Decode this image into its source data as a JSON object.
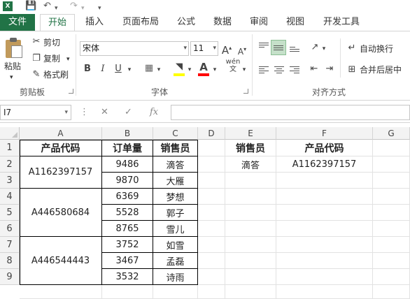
{
  "quick_access": {
    "app_icon": "X",
    "icons": [
      "save-icon",
      "undo-icon",
      "redo-icon",
      "customize-icon"
    ]
  },
  "tabs": [
    "文件",
    "开始",
    "插入",
    "页面布局",
    "公式",
    "数据",
    "审阅",
    "视图",
    "开发工具"
  ],
  "active_tab": "开始",
  "ribbon": {
    "clipboard": {
      "paste": "粘贴",
      "cut": "剪切",
      "copy": "复制",
      "format_painter": "格式刷",
      "group": "剪贴板"
    },
    "font": {
      "name": "宋体",
      "size": "11",
      "grow": "A",
      "shrink": "A",
      "bold": "B",
      "italic": "I",
      "underline": "U",
      "font_color": "A",
      "phonetic": "wén",
      "phonetic_sub": "文",
      "group": "字体",
      "fill_color": "#ffff00",
      "font_color_bar": "#ff0000"
    },
    "alignment": {
      "wrap_text": "自动换行",
      "merge_center": "合并后居中",
      "group": "对齐方式"
    }
  },
  "formula_bar": {
    "name_box": "I7",
    "fx": "fx",
    "value": ""
  },
  "columns": [
    "A",
    "B",
    "C",
    "D",
    "E",
    "F",
    "G"
  ],
  "rows": [
    "1",
    "2",
    "3",
    "4",
    "5",
    "6",
    "7",
    "8",
    "9"
  ],
  "sheet": {
    "headers": {
      "a1": "产品代码",
      "b1": "订单量",
      "c1": "销售员",
      "e1": "销售员",
      "f1": "产品代码"
    },
    "merged_a": [
      "A1162397157",
      "A446580684",
      "A446544443"
    ],
    "orders": [
      "9486",
      "9870",
      "6369",
      "5528",
      "8765",
      "3752",
      "3467",
      "3532"
    ],
    "sales": [
      "滴答",
      "大雁",
      "梦想",
      "郭子",
      "雪儿",
      "如雪",
      "孟磊",
      "诗雨"
    ],
    "lookup": {
      "e2": "滴答",
      "f2": "A1162397157"
    }
  }
}
